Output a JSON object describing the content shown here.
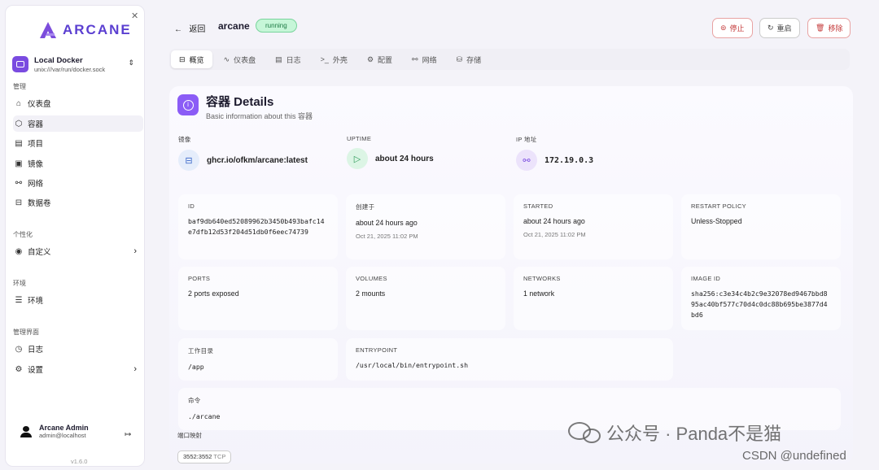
{
  "brand": {
    "name": "ARCANE"
  },
  "env": {
    "name": "Local Docker",
    "socket": "unix:///var/run/docker.sock"
  },
  "sidebar": {
    "sec_manage": "管理",
    "items": [
      {
        "label": "仪表盘"
      },
      {
        "label": "容器"
      },
      {
        "label": "项目"
      },
      {
        "label": "镜像"
      },
      {
        "label": "网络"
      },
      {
        "label": "数据卷"
      }
    ],
    "sec_custom": "个性化",
    "custom": "自定义",
    "sec_env": "环境",
    "env_item": "环境",
    "sec_admin": "管理界面",
    "logs": "日志",
    "settings": "设置"
  },
  "user": {
    "name": "Arcane Admin",
    "email": "admin@localhost"
  },
  "version": "v1.6.0",
  "header": {
    "back": "返回",
    "name": "arcane",
    "status": "running",
    "stop": "停止",
    "restart": "重启",
    "remove": "移除"
  },
  "tabs": [
    "概览",
    "仪表盘",
    "日志",
    "外壳",
    "配置",
    "网络",
    "存储"
  ],
  "details": {
    "title": "容器 Details",
    "subtitle": "Basic information about this 容器",
    "image_label": "镜像",
    "image": "ghcr.io/ofkm/arcane:latest",
    "uptime_label": "UPTIME",
    "uptime": "about 24 hours",
    "ip_label": "IP 地址",
    "ip": "172.19.0.3",
    "id_label": "ID",
    "id": "baf9db640ed52089962b3450b493bafc14e7dfb12d53f204d51db0f6eec74739",
    "created_label": "创建于",
    "created": "about 24 hours ago",
    "created_ts": "Oct 21, 2025 11:02 PM",
    "started_label": "STARTED",
    "started": "about 24 hours ago",
    "started_ts": "Oct 21, 2025 11:02 PM",
    "restart_label": "RESTART POLICY",
    "restart": "Unless-Stopped",
    "ports_label": "PORTS",
    "ports": "2 ports exposed",
    "volumes_label": "VOLUMES",
    "volumes": "2 mounts",
    "networks_label": "NETWORKS",
    "networks": "1 network",
    "imageid_label": "IMAGE ID",
    "imageid": "sha256:c3e34c4b2c9e32078ed9467bbd895ac40bf577c70d4c0dc88b695be3877d4bd6",
    "workdir_label": "工作目录",
    "workdir": "/app",
    "entry_label": "ENTRYPOINT",
    "entry": "/usr/local/bin/entrypoint.sh",
    "cmd_label": "命令",
    "cmd": "./arcane",
    "portmap_label": "端口映射",
    "port": "3552:3552",
    "proto": "TCP"
  },
  "watermark": {
    "wechat": "公众号 · Panda不是猫",
    "csdn": "CSDN @undefined"
  },
  "colors": {
    "accent": "#8b5cf6",
    "running": "#c6f6d8",
    "danger": "#c43b3b"
  }
}
